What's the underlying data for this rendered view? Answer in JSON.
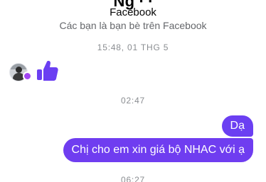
{
  "header": {
    "platform_label": "Facebook",
    "friends_note": "Các bạn là bạn bè trên Facebook"
  },
  "timestamps": [
    "15:48, 01 THG 5",
    "02:47",
    "06:27"
  ],
  "incoming": {
    "reaction_icon": "thumbs-up-icon",
    "accent_color": "#6b3ff2"
  },
  "outgoing_messages": [
    {
      "text": "Dạ"
    },
    {
      "text": "Chị cho em xin giá bộ NHAC với ạ"
    }
  ],
  "colors": {
    "bubble": "#6b3ff2",
    "timestamp": "#8a8d91",
    "subtext": "#65676b"
  }
}
